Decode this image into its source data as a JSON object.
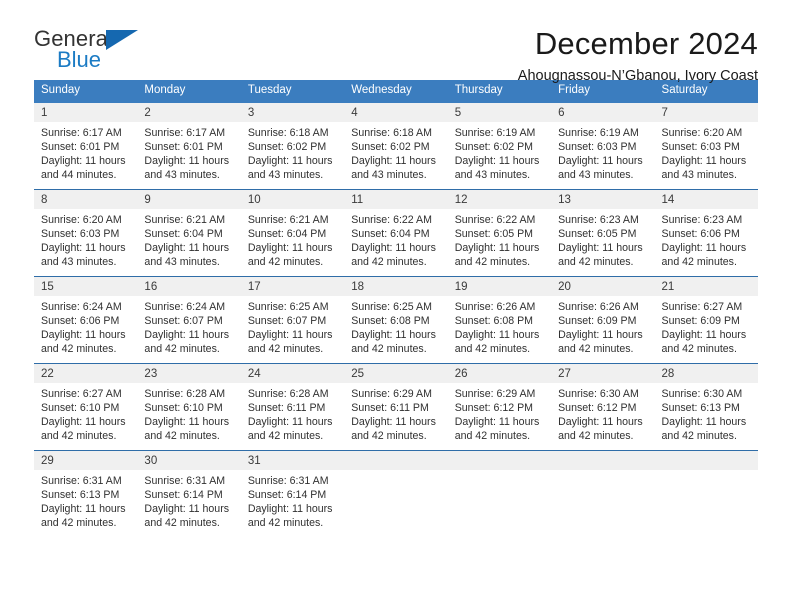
{
  "brand": {
    "name_top": "General",
    "name_bottom": "Blue",
    "color_top": "#333333",
    "color_bottom": "#1b7bc4",
    "triangle_color": "#1568b0"
  },
  "header": {
    "title": "December 2024",
    "subtitle": "Ahougnassou-N’Gbanou, Ivory Coast"
  },
  "theme": {
    "header_row_bg": "#3b7dbf",
    "header_row_text": "#ffffff",
    "daynum_bg": "#f0f0f0",
    "row_divider": "#2f6da8",
    "cell_bg": "#ffffff",
    "body_text": "#303030"
  },
  "calendar": {
    "weekdays": [
      "Sunday",
      "Monday",
      "Tuesday",
      "Wednesday",
      "Thursday",
      "Friday",
      "Saturday"
    ],
    "weeks": [
      [
        {
          "day": "1",
          "lines": [
            "Sunrise: 6:17 AM",
            "Sunset: 6:01 PM",
            "Daylight: 11 hours",
            "and 44 minutes."
          ]
        },
        {
          "day": "2",
          "lines": [
            "Sunrise: 6:17 AM",
            "Sunset: 6:01 PM",
            "Daylight: 11 hours",
            "and 43 minutes."
          ]
        },
        {
          "day": "3",
          "lines": [
            "Sunrise: 6:18 AM",
            "Sunset: 6:02 PM",
            "Daylight: 11 hours",
            "and 43 minutes."
          ]
        },
        {
          "day": "4",
          "lines": [
            "Sunrise: 6:18 AM",
            "Sunset: 6:02 PM",
            "Daylight: 11 hours",
            "and 43 minutes."
          ]
        },
        {
          "day": "5",
          "lines": [
            "Sunrise: 6:19 AM",
            "Sunset: 6:02 PM",
            "Daylight: 11 hours",
            "and 43 minutes."
          ]
        },
        {
          "day": "6",
          "lines": [
            "Sunrise: 6:19 AM",
            "Sunset: 6:03 PM",
            "Daylight: 11 hours",
            "and 43 minutes."
          ]
        },
        {
          "day": "7",
          "lines": [
            "Sunrise: 6:20 AM",
            "Sunset: 6:03 PM",
            "Daylight: 11 hours",
            "and 43 minutes."
          ]
        }
      ],
      [
        {
          "day": "8",
          "lines": [
            "Sunrise: 6:20 AM",
            "Sunset: 6:03 PM",
            "Daylight: 11 hours",
            "and 43 minutes."
          ]
        },
        {
          "day": "9",
          "lines": [
            "Sunrise: 6:21 AM",
            "Sunset: 6:04 PM",
            "Daylight: 11 hours",
            "and 43 minutes."
          ]
        },
        {
          "day": "10",
          "lines": [
            "Sunrise: 6:21 AM",
            "Sunset: 6:04 PM",
            "Daylight: 11 hours",
            "and 42 minutes."
          ]
        },
        {
          "day": "11",
          "lines": [
            "Sunrise: 6:22 AM",
            "Sunset: 6:04 PM",
            "Daylight: 11 hours",
            "and 42 minutes."
          ]
        },
        {
          "day": "12",
          "lines": [
            "Sunrise: 6:22 AM",
            "Sunset: 6:05 PM",
            "Daylight: 11 hours",
            "and 42 minutes."
          ]
        },
        {
          "day": "13",
          "lines": [
            "Sunrise: 6:23 AM",
            "Sunset: 6:05 PM",
            "Daylight: 11 hours",
            "and 42 minutes."
          ]
        },
        {
          "day": "14",
          "lines": [
            "Sunrise: 6:23 AM",
            "Sunset: 6:06 PM",
            "Daylight: 11 hours",
            "and 42 minutes."
          ]
        }
      ],
      [
        {
          "day": "15",
          "lines": [
            "Sunrise: 6:24 AM",
            "Sunset: 6:06 PM",
            "Daylight: 11 hours",
            "and 42 minutes."
          ]
        },
        {
          "day": "16",
          "lines": [
            "Sunrise: 6:24 AM",
            "Sunset: 6:07 PM",
            "Daylight: 11 hours",
            "and 42 minutes."
          ]
        },
        {
          "day": "17",
          "lines": [
            "Sunrise: 6:25 AM",
            "Sunset: 6:07 PM",
            "Daylight: 11 hours",
            "and 42 minutes."
          ]
        },
        {
          "day": "18",
          "lines": [
            "Sunrise: 6:25 AM",
            "Sunset: 6:08 PM",
            "Daylight: 11 hours",
            "and 42 minutes."
          ]
        },
        {
          "day": "19",
          "lines": [
            "Sunrise: 6:26 AM",
            "Sunset: 6:08 PM",
            "Daylight: 11 hours",
            "and 42 minutes."
          ]
        },
        {
          "day": "20",
          "lines": [
            "Sunrise: 6:26 AM",
            "Sunset: 6:09 PM",
            "Daylight: 11 hours",
            "and 42 minutes."
          ]
        },
        {
          "day": "21",
          "lines": [
            "Sunrise: 6:27 AM",
            "Sunset: 6:09 PM",
            "Daylight: 11 hours",
            "and 42 minutes."
          ]
        }
      ],
      [
        {
          "day": "22",
          "lines": [
            "Sunrise: 6:27 AM",
            "Sunset: 6:10 PM",
            "Daylight: 11 hours",
            "and 42 minutes."
          ]
        },
        {
          "day": "23",
          "lines": [
            "Sunrise: 6:28 AM",
            "Sunset: 6:10 PM",
            "Daylight: 11 hours",
            "and 42 minutes."
          ]
        },
        {
          "day": "24",
          "lines": [
            "Sunrise: 6:28 AM",
            "Sunset: 6:11 PM",
            "Daylight: 11 hours",
            "and 42 minutes."
          ]
        },
        {
          "day": "25",
          "lines": [
            "Sunrise: 6:29 AM",
            "Sunset: 6:11 PM",
            "Daylight: 11 hours",
            "and 42 minutes."
          ]
        },
        {
          "day": "26",
          "lines": [
            "Sunrise: 6:29 AM",
            "Sunset: 6:12 PM",
            "Daylight: 11 hours",
            "and 42 minutes."
          ]
        },
        {
          "day": "27",
          "lines": [
            "Sunrise: 6:30 AM",
            "Sunset: 6:12 PM",
            "Daylight: 11 hours",
            "and 42 minutes."
          ]
        },
        {
          "day": "28",
          "lines": [
            "Sunrise: 6:30 AM",
            "Sunset: 6:13 PM",
            "Daylight: 11 hours",
            "and 42 minutes."
          ]
        }
      ],
      [
        {
          "day": "29",
          "lines": [
            "Sunrise: 6:31 AM",
            "Sunset: 6:13 PM",
            "Daylight: 11 hours",
            "and 42 minutes."
          ]
        },
        {
          "day": "30",
          "lines": [
            "Sunrise: 6:31 AM",
            "Sunset: 6:14 PM",
            "Daylight: 11 hours",
            "and 42 minutes."
          ]
        },
        {
          "day": "31",
          "lines": [
            "Sunrise: 6:31 AM",
            "Sunset: 6:14 PM",
            "Daylight: 11 hours",
            "and 42 minutes."
          ]
        },
        {
          "day": "",
          "lines": []
        },
        {
          "day": "",
          "lines": []
        },
        {
          "day": "",
          "lines": []
        },
        {
          "day": "",
          "lines": []
        }
      ]
    ]
  }
}
